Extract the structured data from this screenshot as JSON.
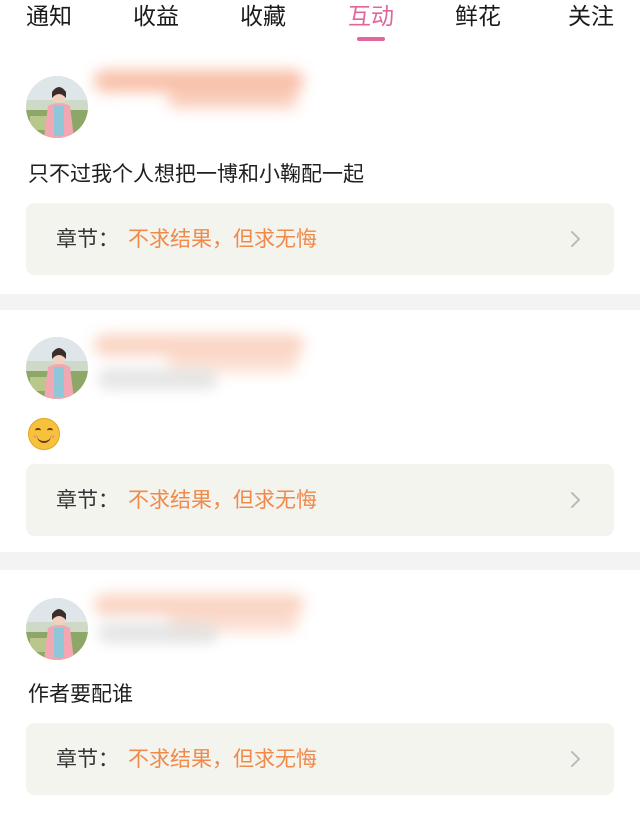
{
  "tabs": [
    {
      "label": "通知",
      "active": false
    },
    {
      "label": "收益",
      "active": false
    },
    {
      "label": "收藏",
      "active": false
    },
    {
      "label": "互动",
      "active": true
    },
    {
      "label": "鲜花",
      "active": false
    },
    {
      "label": "关注",
      "active": false
    }
  ],
  "colors": {
    "accent": "#e0669b",
    "chapter_title": "#f0894a",
    "chapter_bg": "#f4f4ef",
    "divider": "#f3f3f3"
  },
  "icons": {
    "chevron": "chevron-right-icon",
    "emoji": "smiling-face-emoji-icon"
  },
  "interactions": [
    {
      "comment": "只不过我个人想把一博和小鞠配一起",
      "chapter_label": "章节：",
      "chapter_title": "不求结果，但求无悔"
    },
    {
      "comment": "",
      "emoji": "😊",
      "chapter_label": "章节：",
      "chapter_title": "不求结果，但求无悔"
    },
    {
      "comment": "作者要配谁",
      "chapter_label": "章节：",
      "chapter_title": "不求结果，但求无悔"
    }
  ]
}
